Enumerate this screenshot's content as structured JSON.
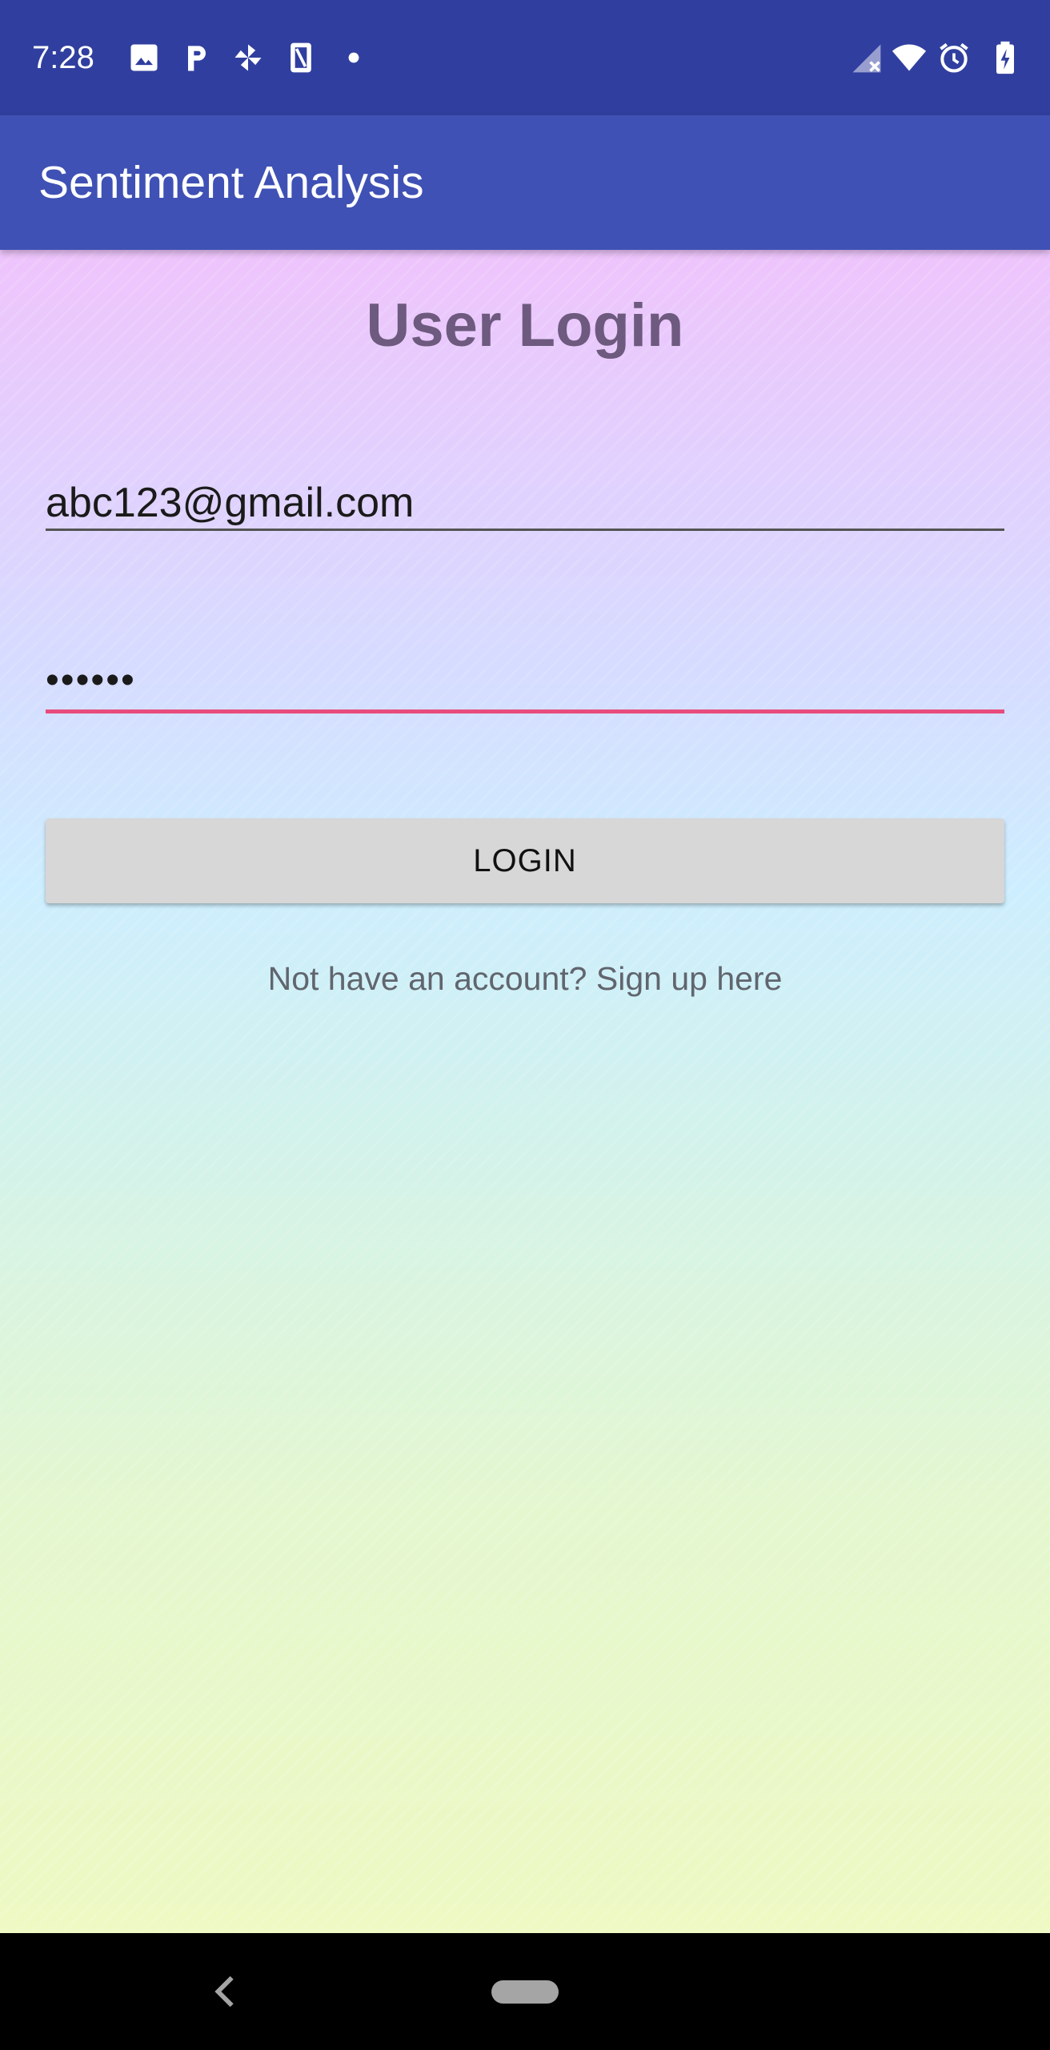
{
  "status_bar": {
    "time": "7:28",
    "left_icons": [
      "image-icon",
      "parking-icon",
      "pinwheel-icon",
      "nfc-card-icon",
      "dot-icon"
    ],
    "right_icons": [
      "signal-off-icon",
      "wifi-icon",
      "alarm-icon",
      "battery-charging-icon"
    ],
    "background": "#303f9f"
  },
  "app_bar": {
    "title": "Sentiment Analysis",
    "background": "#3f51b5"
  },
  "login": {
    "title": "User Login",
    "email_value": "abc123@gmail.com",
    "password_value": "••••••",
    "button_label": "LOGIN",
    "signup_text": "Not have an account? Sign up here"
  },
  "colors": {
    "accent_underline": "#e94b7d",
    "title_color": "#6d5a7e"
  },
  "nav_bar": {
    "icons": [
      "back-icon",
      "home-pill-icon"
    ]
  }
}
